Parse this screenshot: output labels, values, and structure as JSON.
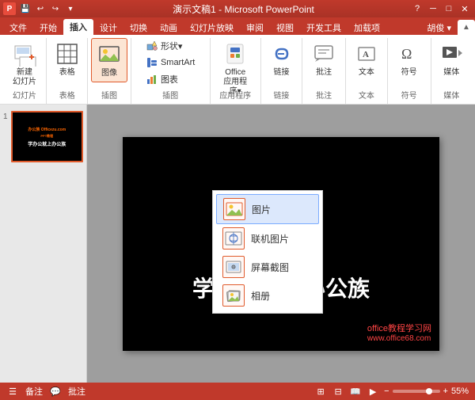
{
  "titlebar": {
    "app_name": "演示文稿1 - Microsoft PowerPoint",
    "quick_access": [
      "保存",
      "撤销",
      "重做",
      "更多"
    ],
    "window_controls": [
      "?",
      "帮助",
      "最小化",
      "最大化",
      "关闭"
    ]
  },
  "ribbon": {
    "tabs": [
      "文件",
      "开始",
      "插入",
      "设计",
      "切换",
      "动画",
      "幻灯片放映",
      "审阅",
      "视图",
      "开发工具",
      "加载项",
      "胡俊"
    ],
    "active_tab": "插入",
    "groups": [
      {
        "id": "newslide",
        "label": "幻灯片",
        "items": [
          {
            "label": "新建\n幻灯片",
            "type": "large"
          }
        ]
      },
      {
        "id": "table",
        "label": "表格",
        "items": [
          {
            "label": "表格",
            "type": "large"
          }
        ]
      },
      {
        "id": "image",
        "label": "插图",
        "items": [
          {
            "label": "图像",
            "type": "large"
          }
        ]
      },
      {
        "id": "shapes",
        "label": "插图",
        "items": [
          {
            "label": "形状▾",
            "type": "small"
          },
          {
            "label": "SmartArt",
            "type": "small"
          },
          {
            "label": "图表",
            "type": "small"
          }
        ]
      },
      {
        "id": "office",
        "label": "应用程序",
        "items": [
          {
            "label": "Office\n应用程序▾",
            "type": "large"
          }
        ]
      },
      {
        "id": "links",
        "label": "链接",
        "items": [
          {
            "label": "链接",
            "type": "large"
          }
        ]
      },
      {
        "id": "comments",
        "label": "批注",
        "items": [
          {
            "label": "批注",
            "type": "large"
          }
        ]
      },
      {
        "id": "text",
        "label": "文本",
        "items": [
          {
            "label": "文本",
            "type": "large"
          }
        ]
      },
      {
        "id": "symbols",
        "label": "符号",
        "items": [
          {
            "label": "符号",
            "type": "large"
          }
        ]
      },
      {
        "id": "media",
        "label": "媒体",
        "items": [
          {
            "label": "媒体",
            "type": "large"
          }
        ]
      }
    ]
  },
  "dropdown": {
    "items": [
      {
        "label": "图片",
        "selected": true
      },
      {
        "label": "联机图片"
      },
      {
        "label": "屏幕截图"
      },
      {
        "label": "相册"
      }
    ]
  },
  "slide": {
    "watermark_site": "办公族",
    "watermark_url": "Officezu.com",
    "watermark_ppt": "PPT教程",
    "main_text": "学办公就上办公族",
    "bottom_link": "office教程学习网",
    "bottom_url": "www.office68.com"
  },
  "statusbar": {
    "slide_info": "备注",
    "comments": "批注",
    "zoom": "55%",
    "view_icons": [
      "普通视图",
      "幻灯片浏览",
      "阅读视图",
      "幻灯片放映"
    ]
  },
  "slide_thumbnail": {
    "number": "1",
    "text": "学办公就上办公族"
  }
}
